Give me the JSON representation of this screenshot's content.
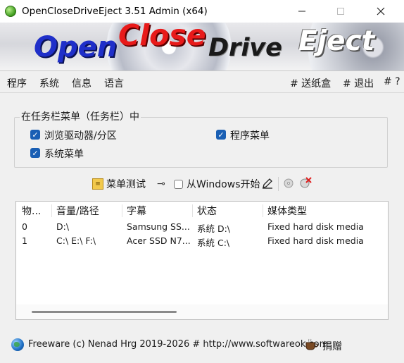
{
  "window": {
    "title": "OpenCloseDriveEject 3.51 Admin (x64)"
  },
  "banner": {
    "word1": "Open",
    "word2": "Close",
    "word3": "Drive",
    "word4": "Eject"
  },
  "menu": {
    "left": [
      "程序",
      "系统",
      "信息",
      "语言"
    ],
    "right": [
      "# 送纸盒",
      "# 退出",
      "# ?"
    ]
  },
  "group": {
    "title": "在任务栏菜单（任务栏）中",
    "browse_label": "浏览驱动器/分区",
    "system_label": "系统菜单",
    "program_label": "程序菜单",
    "browse_checked": true,
    "system_checked": true,
    "program_checked": true
  },
  "toolbar": {
    "menu_test_label": "菜单测试",
    "start_with_windows_label": "从Windows开始",
    "start_with_windows_checked": false
  },
  "list": {
    "columns": [
      "物...",
      "音量/路径",
      "字幕",
      "状态",
      "媒体类型"
    ],
    "rows": [
      [
        "0",
        "D:\\",
        "Samsung SS...",
        "系统 D:\\",
        "Fixed hard disk media"
      ],
      [
        "1",
        "C:\\ E:\\ F:\\",
        "Acer SSD N7...",
        "系统 C:\\",
        "Fixed hard disk media"
      ]
    ]
  },
  "statusbar": {
    "text": "Freeware (c) Nenad Hrg 2019-2026 # http://www.softwareok.com",
    "donate_label": "捐赠"
  },
  "colors": {
    "checkbox": "#1a5fb4",
    "banner_open": "#1f2fc9",
    "banner_close": "#e81a1a"
  }
}
